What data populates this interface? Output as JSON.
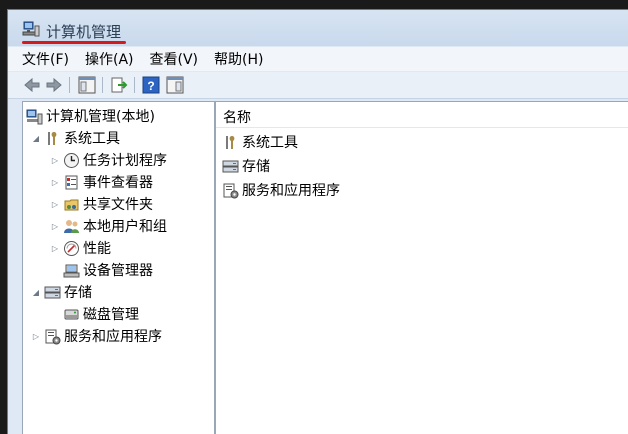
{
  "window": {
    "title": "计算机管理"
  },
  "menubar": {
    "items": [
      {
        "label": "文件(F)"
      },
      {
        "label": "操作(A)"
      },
      {
        "label": "查看(V)"
      },
      {
        "label": "帮助(H)"
      }
    ]
  },
  "toolbar": {
    "buttons": [
      "back-arrow-icon",
      "forward-arrow-icon",
      "show-hide-tree-icon",
      "export-list-icon",
      "help-icon",
      "show-hide-action-pane-icon"
    ]
  },
  "tree": {
    "root": "计算机管理(本地)",
    "system_tools": "系统工具",
    "task_scheduler": "任务计划程序",
    "event_viewer": "事件查看器",
    "shared_folders": "共享文件夹",
    "local_users": "本地用户和组",
    "performance": "性能",
    "device_manager": "设备管理器",
    "storage": "存储",
    "disk_management": "磁盘管理",
    "services_apps": "服务和应用程序"
  },
  "list": {
    "column_name": "名称",
    "items": [
      "系统工具",
      "存储",
      "服务和应用程序"
    ]
  },
  "colors": {
    "accent_underline": "#d41a1a",
    "window_frame": "#dfe9f5"
  }
}
